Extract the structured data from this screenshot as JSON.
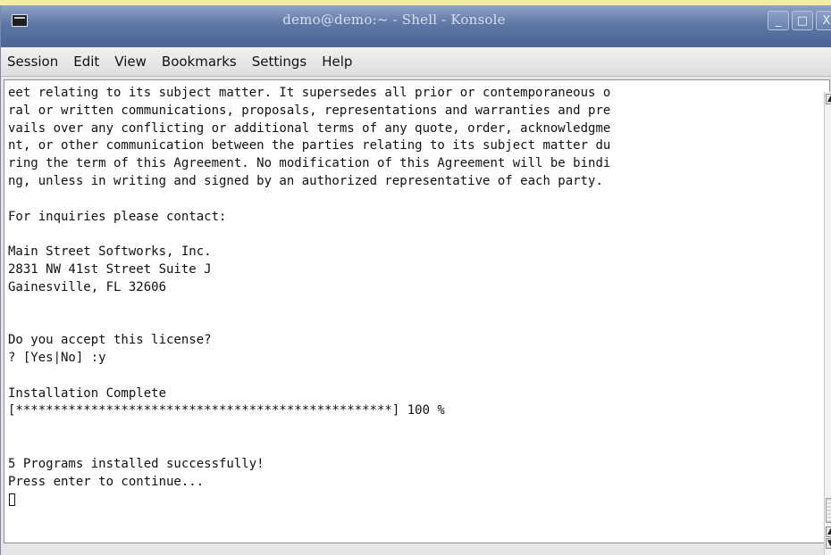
{
  "window": {
    "title": "demo@demo:~ - Shell - Konsole",
    "buttons": {
      "minimize": "_",
      "maximize": "□",
      "close": "X"
    }
  },
  "menu": {
    "items": [
      "Session",
      "Edit",
      "View",
      "Bookmarks",
      "Settings",
      "Help"
    ]
  },
  "terminal": {
    "lines": [
      "eet relating to its subject matter. It supersedes all prior or contemporaneous o",
      "ral or written communications, proposals, representations and warranties and pre",
      "vails over any conflicting or additional terms of any quote, order, acknowledgme",
      "nt, or other communication between the parties relating to its subject matter du",
      "ring the term of this Agreement. No modification of this Agreement will be bindi",
      "ng, unless in writing and signed by an authorized representative of each party.",
      "",
      "For inquiries please contact:",
      "",
      "Main Street Softworks, Inc.",
      "2831 NW 41st Street Suite J",
      "Gainesville, FL 32606",
      "",
      "",
      "Do you accept this license?",
      "? [Yes|No] :y",
      "",
      "Installation Complete",
      "[**************************************************] 100 %",
      "",
      "",
      "5 Programs installed successfully!",
      "Press enter to continue..."
    ]
  },
  "scrollbar": {
    "up_arrow": "▲",
    "down_arrow": "▼"
  }
}
